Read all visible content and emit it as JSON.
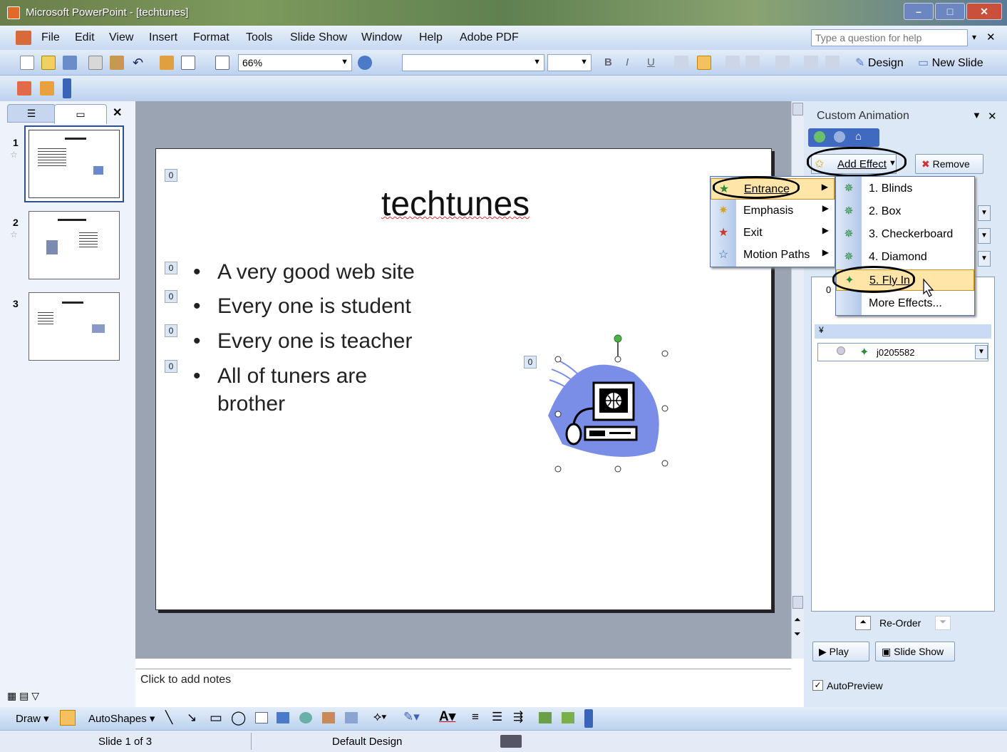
{
  "window": {
    "title": "Microsoft PowerPoint - [techtunes]"
  },
  "menubar": {
    "items": [
      "File",
      "Edit",
      "View",
      "Insert",
      "Format",
      "Tools",
      "Slide Show",
      "Window",
      "Help",
      "Adobe PDF"
    ],
    "help_placeholder": "Type a question for help"
  },
  "toolbar": {
    "zoom": "66%",
    "design_label": "Design",
    "new_slide_label": "New Slide"
  },
  "slides": [
    {
      "number": "1"
    },
    {
      "number": "2"
    },
    {
      "number": "3"
    }
  ],
  "slide": {
    "title": "techtunes",
    "bullets": [
      "A very good web site",
      "Every one is student",
      "Every one is teacher",
      "All of tuners are",
      "brother"
    ],
    "anim_tags": [
      "0",
      "0",
      "0",
      "0",
      "0",
      "0"
    ]
  },
  "notes": {
    "placeholder": "Click to add notes"
  },
  "taskpane": {
    "title": "Custom Animation",
    "add_effect": "Add Effect",
    "remove": "Remove",
    "list_item_tag": "0",
    "list_item_name": "j0205582",
    "reorder": "Re-Order",
    "play": "Play",
    "slide_show": "Slide Show",
    "autopreview": "AutoPreview"
  },
  "effect_menu": {
    "items": [
      "Entrance",
      "Emphasis",
      "Exit",
      "Motion Paths"
    ]
  },
  "entrance_submenu": {
    "items": [
      "1. Blinds",
      "2. Box",
      "3. Checkerboard",
      "4. Diamond",
      "5. Fly In"
    ],
    "more": "More Effects..."
  },
  "drawbar": {
    "draw": "Draw",
    "autoshapes": "AutoShapes"
  },
  "status": {
    "slide_position": "Slide 1 of 3",
    "design": "Default Design"
  },
  "colors": {
    "accent": "#316ac5",
    "highlight": "#ffe6a8",
    "star_green": "#2e8b3a"
  }
}
